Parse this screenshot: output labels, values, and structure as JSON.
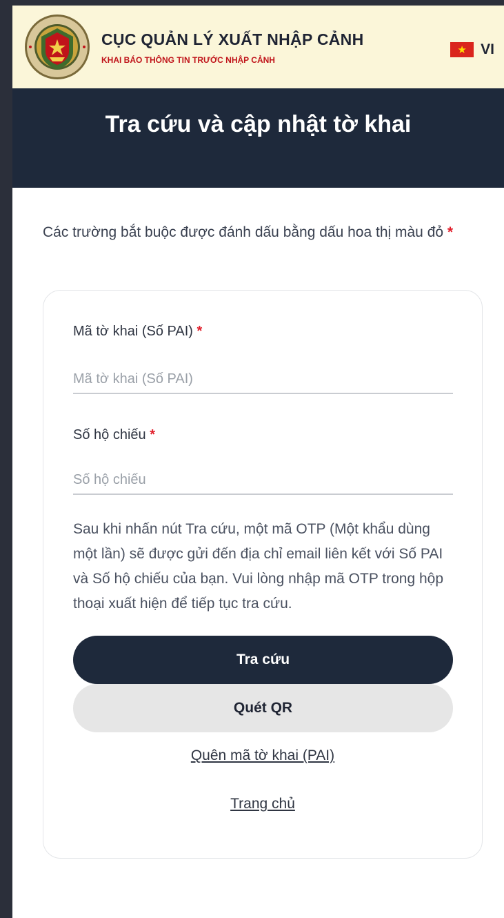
{
  "header": {
    "org_title": "CỤC QUẢN LÝ XUẤT NHẬP CẢNH",
    "org_subtitle": "KHAI BÁO THÔNG TIN TRƯỚC NHẬP CẢNH",
    "emblem_icon": "immigration-emblem-icon",
    "language": {
      "flag_icon": "vietnam-flag-icon",
      "code": "VI"
    }
  },
  "title_bar": {
    "title": "Tra cứu và cập nhật tờ khai"
  },
  "form": {
    "required_note": "Các trường bắt buộc được đánh dấu bằng dấu hoa thị màu đỏ",
    "required_marker": "*",
    "fields": [
      {
        "label": "Mã tờ khai (Số PAI)",
        "placeholder": "Mã tờ khai (Số PAI)",
        "value": ""
      },
      {
        "label": "Số hộ chiếu",
        "placeholder": "Số hộ chiếu",
        "value": ""
      }
    ],
    "info_text": "Sau khi nhấn nút Tra cứu, một mã OTP (Một khẩu dùng một lần) sẽ được gửi đến địa chỉ email liên kết với Số PAI và Số hộ chiếu của bạn. Vui lòng nhập mã OTP trong hộp thoại xuất hiện để tiếp tục tra cứu.",
    "lookup_button": "Tra cứu",
    "scan_qr_button": "Quét QR",
    "forgot_link": "Quên mã tờ khai (PAI)",
    "home_link": "Trang chủ"
  },
  "colors": {
    "header_bg": "#fbf6d9",
    "title_bar_bg": "#1e293b",
    "primary_button": "#1e293b",
    "secondary_button": "#e6e6e6",
    "required_star": "#e11d2a",
    "subtitle_red": "#c0141a"
  }
}
